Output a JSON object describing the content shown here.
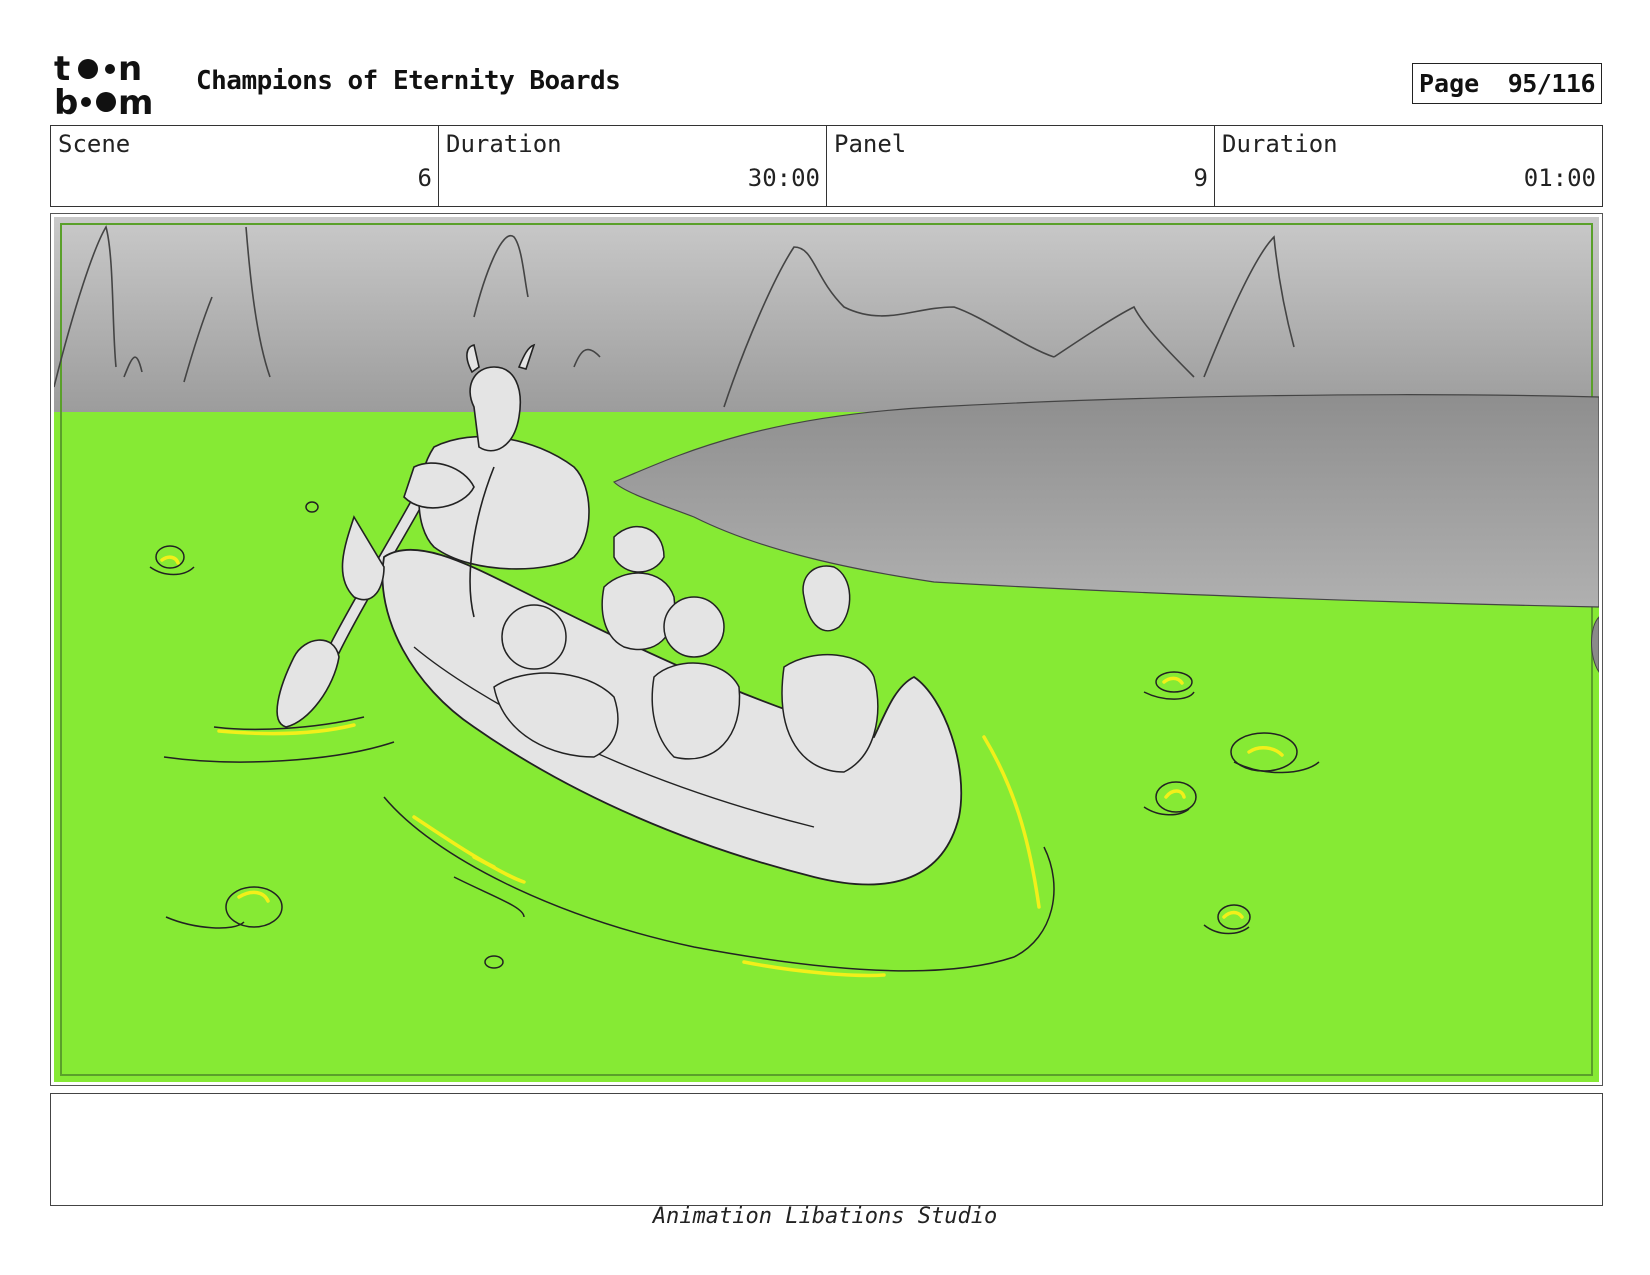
{
  "header": {
    "logo_name": "toon-boom-logo",
    "title": "Champions of Eternity Boards",
    "page_label": "Page",
    "page_number": "95/116"
  },
  "info": {
    "scene_label": "Scene",
    "scene_value": "6",
    "scene_duration_label": "Duration",
    "scene_duration_value": "30:00",
    "panel_label": "Panel",
    "panel_value": "9",
    "panel_duration_label": "Duration",
    "panel_duration_value": "01:00"
  },
  "panel_image": {
    "colors": {
      "water": "#86ea34",
      "sky": "#b8b8b8",
      "canoe": "#e4e4e4",
      "highlight": "#f2ef1a",
      "lake": "#9e9e9e"
    }
  },
  "notes": {
    "text": ""
  },
  "footer": {
    "studio": "Animation Libations Studio"
  }
}
